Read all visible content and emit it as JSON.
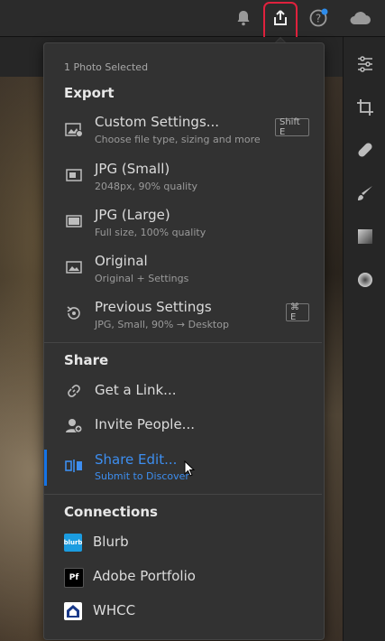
{
  "menu": {
    "selection_count": "1 Photo Selected",
    "export": {
      "title": "Export",
      "items": [
        {
          "label": "Custom Settings...",
          "sub": "Choose file type, sizing and more",
          "shortcut": "Shift E",
          "icon": "custom-settings-icon"
        },
        {
          "label": "JPG (Small)",
          "sub": "2048px, 90% quality",
          "icon": "jpg-small-icon"
        },
        {
          "label": "JPG (Large)",
          "sub": "Full size, 100% quality",
          "icon": "jpg-large-icon"
        },
        {
          "label": "Original",
          "sub": "Original + Settings",
          "icon": "original-icon"
        },
        {
          "label": "Previous Settings",
          "sub": "JPG, Small, 90% → Desktop",
          "shortcut": "⌘ E",
          "icon": "previous-settings-icon"
        }
      ]
    },
    "share": {
      "title": "Share",
      "items": [
        {
          "label": "Get a Link...",
          "icon": "link-icon"
        },
        {
          "label": "Invite People...",
          "icon": "invite-people-icon"
        },
        {
          "label": "Share Edit...",
          "sub": "Submit to Discover",
          "icon": "share-edit-icon"
        }
      ]
    },
    "connections": {
      "title": "Connections",
      "items": [
        {
          "label": "Blurb",
          "logo": "blurb"
        },
        {
          "label": "Adobe Portfolio",
          "logo": "Pf"
        },
        {
          "label": "WHCC",
          "icon": "whcc-icon"
        }
      ]
    }
  },
  "colors": {
    "accent": "#1473e6",
    "highlight_border": "#e0213d",
    "notification_dot": "#2d8ceb",
    "menu_bg": "#323232"
  },
  "topbar_icons": [
    "bell-icon",
    "share-icon",
    "help-icon",
    "cloud-icon"
  ],
  "right_panel_icons": [
    "sliders-icon",
    "crop-icon",
    "healing-icon",
    "brush-icon",
    "gradient-icon",
    "radial-icon"
  ]
}
